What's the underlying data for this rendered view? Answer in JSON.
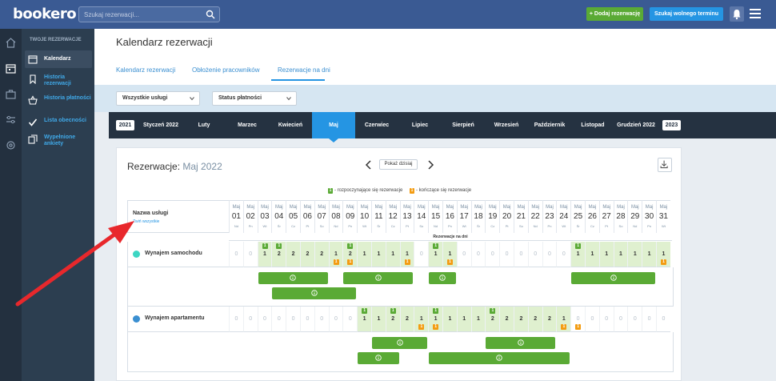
{
  "topbar": {
    "logo": "bookero",
    "search_placeholder": "Szukaj rezerwacji...",
    "add_button": "+ Dodaj rezerwację",
    "find_button": "Szukaj wolnego terminu"
  },
  "sidebar": {
    "section_title": "TWOJE REZERWACJE",
    "items": [
      {
        "label": "Kalendarz",
        "icon": "calendar-icon",
        "active": true
      },
      {
        "label": "Historia rezerwacji",
        "icon": "bookmark-icon",
        "active": false
      },
      {
        "label": "Historia płatności",
        "icon": "basket-icon",
        "active": false
      },
      {
        "label": "Lista obecności",
        "icon": "check-icon",
        "active": false
      },
      {
        "label": "Wypełnione ankiety",
        "icon": "copy-icon",
        "active": false
      }
    ]
  },
  "header": {
    "title": "Kalendarz rezerwacji",
    "tabs": [
      "Kalendarz rezerwacji",
      "Obłożenie pracowników",
      "Rezerwacje na dni"
    ],
    "active_tab": 2
  },
  "filters": {
    "services": "Wszystkie usługi",
    "payment": "Status płatności"
  },
  "months_bar": {
    "year_prev": "2021",
    "year_next": "2023",
    "months": [
      "Styczeń 2022",
      "Luty",
      "Marzec",
      "Kwiecień",
      "Maj",
      "Czerwiec",
      "Lipiec",
      "Sierpień",
      "Wrzesień",
      "Październik",
      "Listopad",
      "Grudzień 2022"
    ],
    "active_index": 4
  },
  "card": {
    "title": "Rezerwacje:",
    "period": "Maj 2022",
    "today_button": "Pokaż dzisiaj",
    "legend_start": "- rozpoczynające się rezerwacje",
    "legend_end": "- kończące się rezerwacje",
    "legend_start_num": "1",
    "legend_end_num": "1",
    "service_header": "Nazwa usługi",
    "collapse_link": "Zwiń wszystkie",
    "reservations_label": "Rezerwacje na dni",
    "month_short": "Maj",
    "days": [
      "01",
      "02",
      "03",
      "04",
      "05",
      "06",
      "07",
      "08",
      "09",
      "10",
      "11",
      "12",
      "13",
      "14",
      "15",
      "16",
      "17",
      "18",
      "19",
      "20",
      "21",
      "22",
      "23",
      "24",
      "25",
      "26",
      "27",
      "28",
      "29",
      "30",
      "31"
    ],
    "weekdays": [
      "Nd",
      "Pn",
      "Wt",
      "Śr",
      "Cz",
      "Pt",
      "So",
      "Nd",
      "Pn",
      "Wt",
      "Śr",
      "Cz",
      "Pt",
      "So",
      "Nd",
      "Pn",
      "Wt",
      "Śr",
      "Cz",
      "Pt",
      "So",
      "Nd",
      "Pn",
      "Wt",
      "Śr",
      "Cz",
      "Pt",
      "So",
      "Nd",
      "Pn",
      "Wt"
    ],
    "services": [
      {
        "name": "Wynajem samochodu",
        "color": "#3dd6c3",
        "counts": [
          0,
          0,
          1,
          2,
          2,
          2,
          2,
          1,
          2,
          1,
          1,
          1,
          1,
          0,
          1,
          1,
          0,
          0,
          0,
          0,
          0,
          0,
          0,
          0,
          1,
          1,
          1,
          1,
          1,
          1,
          1
        ],
        "starts": [
          0,
          0,
          1,
          1,
          0,
          0,
          0,
          0,
          1,
          0,
          0,
          0,
          0,
          0,
          1,
          0,
          0,
          0,
          0,
          0,
          0,
          0,
          0,
          0,
          1,
          0,
          0,
          0,
          0,
          0,
          0
        ],
        "ends": [
          0,
          0,
          0,
          0,
          0,
          0,
          0,
          1,
          1,
          0,
          0,
          0,
          1,
          0,
          0,
          1,
          0,
          0,
          0,
          0,
          0,
          0,
          0,
          0,
          0,
          0,
          0,
          0,
          0,
          0,
          1
        ]
      },
      {
        "name": "Wynajem apartamentu",
        "color": "#3a8fd1",
        "counts": [
          0,
          0,
          0,
          0,
          0,
          0,
          0,
          0,
          0,
          1,
          1,
          2,
          2,
          1,
          1,
          1,
          1,
          1,
          2,
          2,
          2,
          2,
          2,
          1,
          0,
          0,
          0,
          0,
          0,
          0,
          0
        ],
        "starts": [
          0,
          0,
          0,
          0,
          0,
          0,
          0,
          0,
          0,
          1,
          0,
          1,
          0,
          0,
          1,
          0,
          0,
          0,
          1,
          0,
          0,
          0,
          0,
          0,
          0,
          0,
          0,
          0,
          0,
          0,
          0
        ],
        "ends": [
          0,
          0,
          0,
          0,
          0,
          0,
          0,
          0,
          0,
          0,
          0,
          0,
          0,
          1,
          1,
          0,
          0,
          0,
          0,
          0,
          0,
          0,
          0,
          1,
          1,
          0,
          0,
          0,
          0,
          0,
          0
        ]
      }
    ],
    "reservation_bars": [
      {
        "service": 0,
        "row": 0,
        "start": 3,
        "end": 7
      },
      {
        "service": 0,
        "row": 0,
        "start": 9,
        "end": 13
      },
      {
        "service": 0,
        "row": 0,
        "start": 15,
        "end": 16
      },
      {
        "service": 0,
        "row": 0,
        "start": 25,
        "end": 30
      },
      {
        "service": 0,
        "row": 1,
        "start": 4,
        "end": 9
      },
      {
        "service": 1,
        "row": 0,
        "start": 11,
        "end": 14
      },
      {
        "service": 1,
        "row": 0,
        "start": 19,
        "end": 23
      },
      {
        "service": 1,
        "row": 1,
        "start": 10,
        "end": 12
      },
      {
        "service": 1,
        "row": 1,
        "start": 15,
        "end": 24
      }
    ]
  }
}
